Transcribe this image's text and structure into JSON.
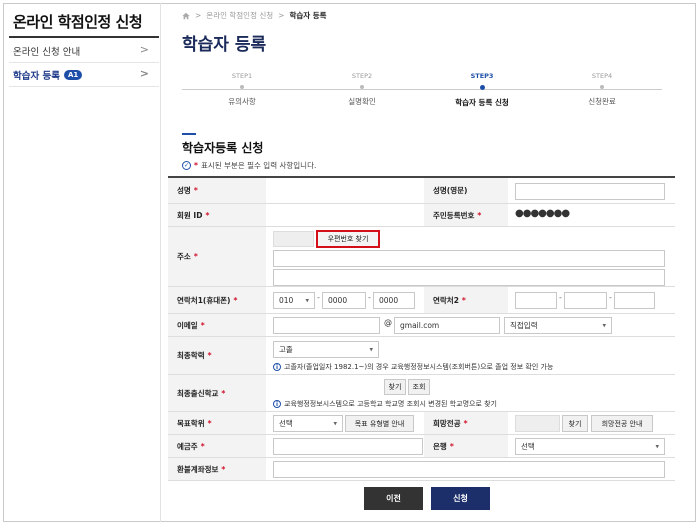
{
  "sidebar": {
    "title": "온라인 학점인정 신청",
    "items": [
      {
        "label": "온라인 신청 안내",
        "chevron": ">"
      },
      {
        "label": "학습자 등록",
        "badge": "A1",
        "chevron": ">"
      }
    ]
  },
  "breadcrumb": {
    "items": [
      "온라인 학점인정 신청",
      "학습자 등록"
    ],
    "separator": ">"
  },
  "page_title": "학습자 등록",
  "steps": [
    {
      "num": "STEP1",
      "label": "유의사항"
    },
    {
      "num": "STEP2",
      "label": "실명확인"
    },
    {
      "num": "STEP3",
      "label": "학습자 등록 신청",
      "active": true
    },
    {
      "num": "STEP4",
      "label": "신청완료"
    }
  ],
  "section": {
    "title": "학습자등록 신청",
    "required_note": "표시된 부분은 필수 입력 사항입니다.",
    "required_mark": "*"
  },
  "form": {
    "name_label": "성명",
    "name_en_label": "성명(영문)",
    "member_id_label": "회원 ID",
    "rrn_label": "주민등록번호",
    "rrn_mask": "●●●●●●●",
    "address_label": "주소",
    "postcode_button": "우편번호 찾기",
    "phone1_label": "연락처1(휴대폰)",
    "phone1_prefix": "010",
    "phone1_mid": "0000",
    "phone1_last": "0000",
    "phone2_label": "연락처2",
    "dash": "-",
    "email_label": "이메일",
    "email_at": "@",
    "email_domain": "gmail.com",
    "email_select": "직접입력",
    "education_label": "최종학력",
    "education_value": "고졸",
    "education_info": "고졸자(졸업일자 1982.1~)의 경우 교육행정정보시스템(조회버튼)으로 졸업 정보 확인 가능",
    "school_label": "최종출신학교",
    "school_find_button": "찾기",
    "school_lookup_button": "조회",
    "school_info": "교육행정정보시스템으로 고등학교 학교명 조회시 변경된 학교명으로 찾기",
    "degree_label": "목표학위",
    "degree_select": "선택",
    "degree_guide_button": "목표 유형별 안내",
    "major_label": "희망전공",
    "major_find_button": "찾기",
    "major_guide_button": "희망전공 안내",
    "depositor_label": "예금주",
    "bank_label": "은행",
    "bank_select": "선택",
    "refund_label": "환불계좌정보"
  },
  "buttons": {
    "prev": "이전",
    "submit": "신청"
  },
  "colors": {
    "accent": "#1e4fa8",
    "required": "#d0112b",
    "highlight": "#d40f1a",
    "submit": "#1c2f6b"
  }
}
